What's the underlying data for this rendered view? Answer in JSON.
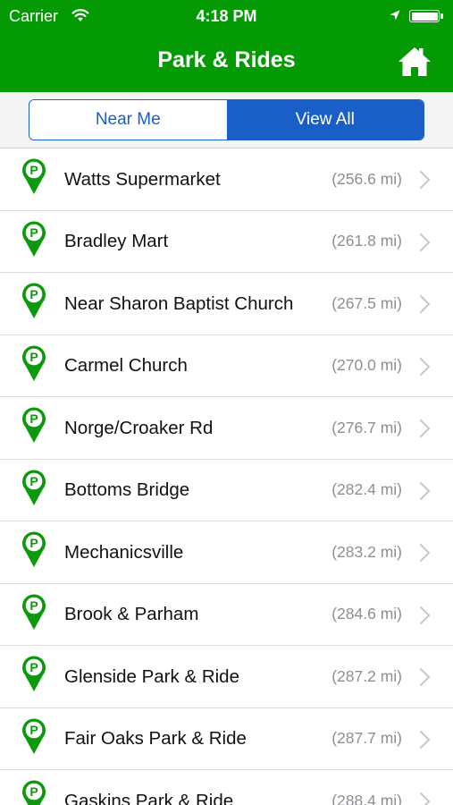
{
  "status_bar": {
    "carrier": "Carrier",
    "time": "4:18 PM",
    "icons": [
      "wifi-icon",
      "location-arrow-icon",
      "battery-icon"
    ]
  },
  "header": {
    "title": "Park & Rides",
    "background": "#049a04",
    "home_icon": "home-icon"
  },
  "segments": {
    "near_me": "Near Me",
    "view_all": "View All",
    "selected": "view_all",
    "accent": "#1a5fc7"
  },
  "list": {
    "pin_icon": "parking-pin-icon",
    "chevron_icon": "chevron-right-icon",
    "items": [
      {
        "name": "Watts Supermarket",
        "distance": "(256.6 mi)"
      },
      {
        "name": "Bradley Mart",
        "distance": "(261.8 mi)"
      },
      {
        "name": "Near Sharon Baptist Church",
        "distance": "(267.5 mi)"
      },
      {
        "name": "Carmel Church",
        "distance": "(270.0 mi)"
      },
      {
        "name": "Norge/Croaker Rd",
        "distance": "(276.7 mi)"
      },
      {
        "name": "Bottoms Bridge",
        "distance": "(282.4 mi)"
      },
      {
        "name": "Mechanicsville",
        "distance": "(283.2 mi)"
      },
      {
        "name": "Brook & Parham",
        "distance": "(284.6 mi)"
      },
      {
        "name": "Glenside Park & Ride",
        "distance": "(287.2 mi)"
      },
      {
        "name": "Fair Oaks Park & Ride",
        "distance": "(287.7 mi)"
      },
      {
        "name": "Gaskins Park & Ride",
        "distance": "(288.4 mi)"
      }
    ]
  }
}
